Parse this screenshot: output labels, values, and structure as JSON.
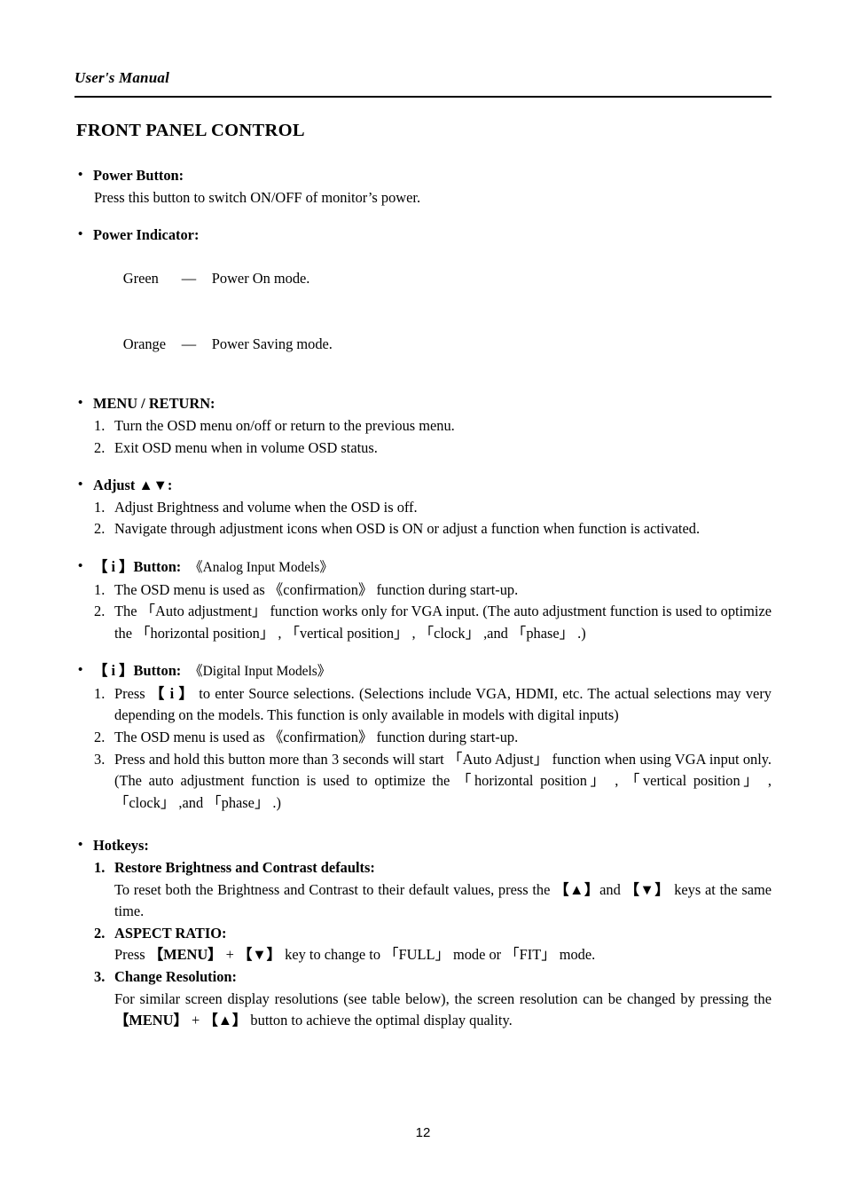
{
  "header": {
    "running_title": "User's Manual"
  },
  "title": "FRONT PANEL CONTROL",
  "sections": {
    "power_button": {
      "label": "Power Button:",
      "body": "Press this button to switch ON/OFF of monitor’s power."
    },
    "power_indicator": {
      "label": "Power Indicator:",
      "rows": [
        {
          "term": "Green",
          "dash": "—",
          "desc": "Power On mode."
        },
        {
          "term": "Orange",
          "dash": "—",
          "desc": "Power Saving mode."
        }
      ]
    },
    "menu_return": {
      "label": "MENU / RETURN:",
      "items": [
        {
          "marker": "1.",
          "text": "Turn the OSD menu on/off or return to the previous menu."
        },
        {
          "marker": "2.",
          "text": "Exit OSD menu when in volume OSD status."
        }
      ]
    },
    "adjust": {
      "label": "Adjust ▲▼:",
      "items": [
        {
          "marker": "1.",
          "text": "Adjust Brightness and volume when the OSD is off."
        },
        {
          "marker": "2.",
          "text": "Navigate through adjustment icons when OSD is ON or adjust a function when function is activated."
        }
      ]
    },
    "i_button_analog": {
      "label": "【 i 】Button:",
      "qualifier": "《Analog Input Models》",
      "items": [
        {
          "marker": "1.",
          "text": "The OSD menu is used as 《confirmation》 function during start-up."
        },
        {
          "marker": "2.",
          "text": "The 「Auto adjustment」 function works only for VGA input. (The auto adjustment function is used to optimize the 「horizontal position」 , 「vertical position」 , 「clock」 ,and 「phase」 .)"
        }
      ]
    },
    "i_button_digital": {
      "label": "【 i 】Button:",
      "qualifier": "《Digital Input Models》",
      "items": [
        {
          "marker": "1.",
          "text": "Press 【 i 】 to enter Source selections. (Selections include VGA, HDMI, etc. The actual selections may very depending on the models. This function is only available in models with digital inputs)"
        },
        {
          "marker": "2.",
          "text": "The OSD menu is used as 《confirmation》 function during start-up."
        },
        {
          "marker": "3.",
          "text": "Press and hold this button more than 3 seconds will start 「Auto Adjust」 function when using VGA input only. (The auto adjustment function is used to optimize the 「horizontal position」 , 「vertical position」 , 「clock」 ,and 「phase」 .)"
        }
      ]
    },
    "hotkeys": {
      "label": "Hotkeys:",
      "items": [
        {
          "marker": "1.",
          "heading": "Restore Brightness and Contrast defaults:",
          "body": "To reset both the Brightness and Contrast to their default values, press the 【▲】and 【▼】 keys at the same time."
        },
        {
          "marker": "2.",
          "heading": "ASPECT RATIO:",
          "body": "Press 【MENU】 + 【▼】 key to change to 「FULL」 mode or 「FIT」 mode."
        },
        {
          "marker": "3.",
          "heading": "Change Resolution:",
          "body": "For similar screen display resolutions (see table below), the screen resolution can be changed by pressing the 【MENU】 + 【▲】 button to achieve the optimal display quality."
        }
      ]
    }
  },
  "folio": "12"
}
